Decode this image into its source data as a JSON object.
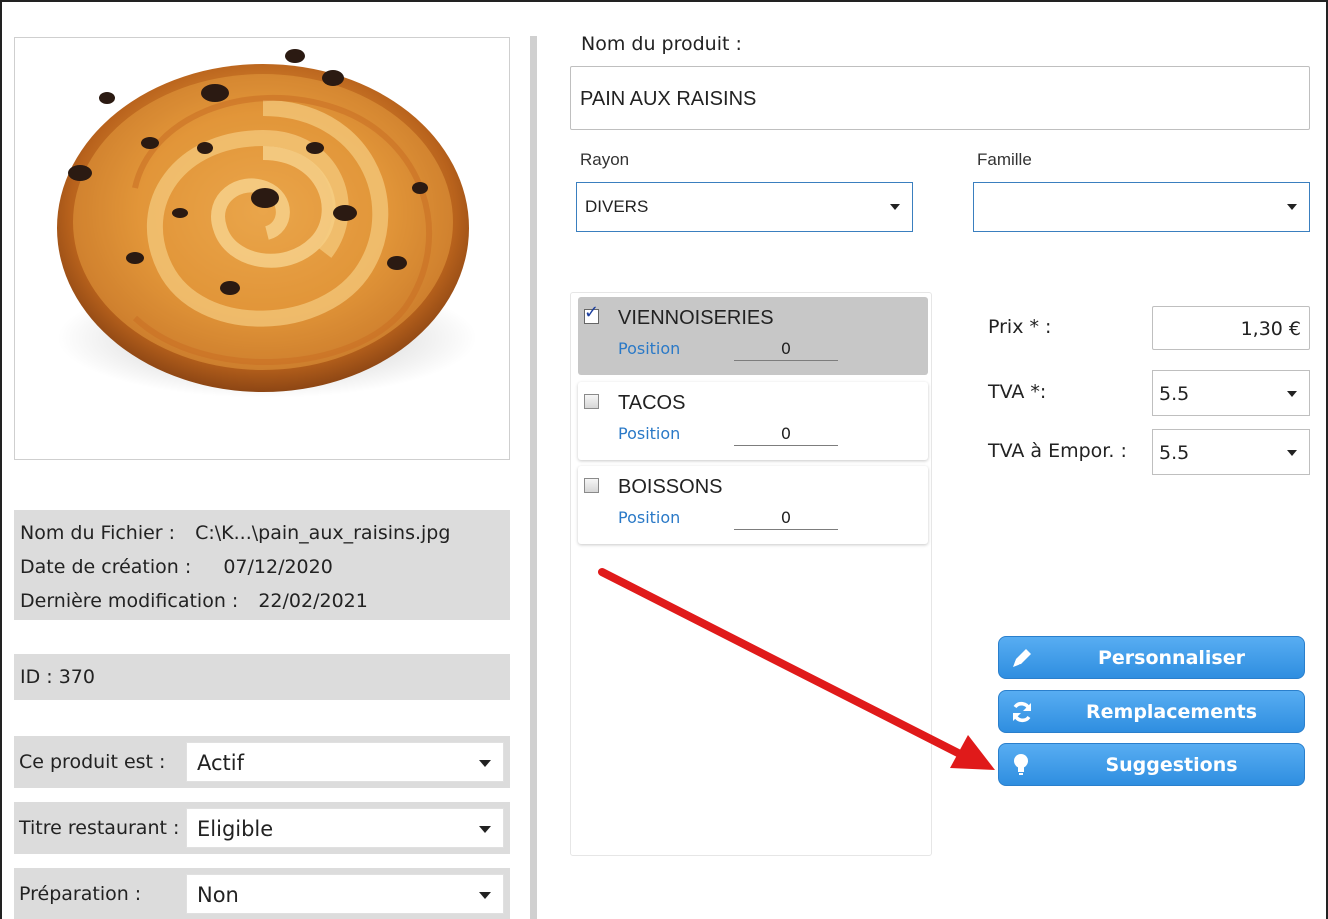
{
  "file_info": {
    "name_label": "Nom du Fichier :",
    "name_value": "C:\\K...\\pain_aux_raisins.jpg",
    "created_label": "Date de création :",
    "created_value": "07/12/2020",
    "modified_label": "Dernière modification :",
    "modified_value": "22/02/2021"
  },
  "id_text": "ID : 370",
  "options": {
    "status": {
      "label": "Ce produit est :",
      "value": "Actif"
    },
    "meal_voucher": {
      "label": "Titre restaurant :",
      "value": "Eligible"
    },
    "preparation": {
      "label": "Préparation :",
      "value": "Non"
    }
  },
  "product": {
    "name_label": "Nom du produit :",
    "name_value": "PAIN AUX RAISINS"
  },
  "rayon": {
    "label": "Rayon",
    "value": "DIVERS"
  },
  "famille": {
    "label": "Famille",
    "value": ""
  },
  "families": [
    {
      "name": "VIENNOISERIES",
      "checked": true,
      "position_label": "Position",
      "position_value": "0"
    },
    {
      "name": "TACOS",
      "checked": false,
      "position_label": "Position",
      "position_value": "0"
    },
    {
      "name": "BOISSONS",
      "checked": false,
      "position_label": "Position",
      "position_value": "0"
    }
  ],
  "pricing": {
    "price_label": "Prix * :",
    "price_value": "1,30 €",
    "tva_label": "TVA *:",
    "tva_value": "5.5",
    "tva_takeaway_label": "TVA à Empor. :",
    "tva_takeaway_value": "5.5"
  },
  "actions": {
    "customize": "Personnaliser",
    "replacements": "Remplacements",
    "suggestions": "Suggestions"
  },
  "colors": {
    "button_blue": "#3d9be8",
    "select_border": "#3a7fbf",
    "arrow_red": "#e01a1a",
    "position_blue": "#2a79c7"
  },
  "icons": [
    "pencil-icon",
    "refresh-icon",
    "lightbulb-icon",
    "checkbox-checked-icon",
    "chevron-down-icon"
  ]
}
